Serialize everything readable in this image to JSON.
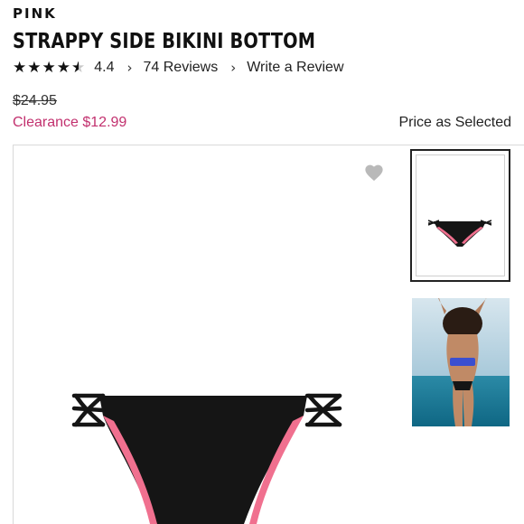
{
  "product": {
    "brand": "PINK",
    "title": "STRAPPY SIDE BIKINI BOTTOM",
    "rating_value": "4.4",
    "rating_stars": 4.4,
    "reviews_label": "74 Reviews",
    "write_review_label": "Write a Review",
    "original_price": "$24.95",
    "clearance_price": "Clearance $12.99",
    "price_note": "Price as Selected"
  },
  "colors": {
    "clearance": "#c2306e",
    "product_pink": "#f0708f",
    "product_black": "#151515",
    "heart": "#b9b9b9"
  },
  "icons": {
    "heart": "heart-icon",
    "chevron": "chevron-right-icon",
    "star": "star-icon"
  }
}
